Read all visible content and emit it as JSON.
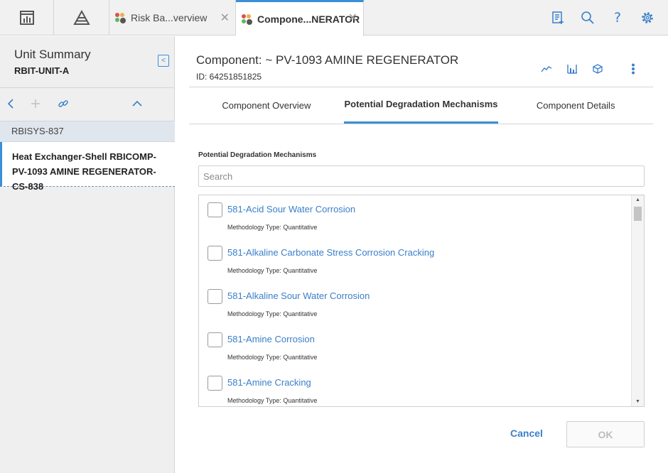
{
  "topbar": {
    "tabs": [
      {
        "label": "Risk Ba...verview",
        "icon": "risk-app-icon"
      },
      {
        "label": "Compone...NERATOR",
        "icon": "risk-app-icon"
      }
    ],
    "icons": [
      "checklist-add-icon",
      "search-icon",
      "help-icon",
      "settings-gear-icon"
    ]
  },
  "left": {
    "title": "Unit Summary",
    "subtitle": "RBIT-UNIT-A",
    "tree": [
      {
        "label": "RBISYS-837"
      },
      {
        "label": "Heat Exchanger-Shell RBICOMP-PV-1093 AMINE REGENERATOR-CS-838"
      }
    ]
  },
  "main": {
    "title": "Component: ~ PV-1093 AMINE REGENERATOR",
    "id_text": "ID: 64251851825",
    "tabs": [
      {
        "label": "Component Overview"
      },
      {
        "label": "Potential Degradation Mechanisms"
      },
      {
        "label": "Component Details"
      }
    ],
    "section_label": "Potential Degradation Mechanisms",
    "search_placeholder": "Search",
    "items": [
      {
        "name": "581-Acid Sour Water Corrosion",
        "methodology": "Methodology Type: Quantitative"
      },
      {
        "name": "581-Alkaline Carbonate Stress Corrosion Cracking",
        "methodology": "Methodology Type: Quantitative"
      },
      {
        "name": "581-Alkaline Sour Water Corrosion",
        "methodology": "Methodology Type: Quantitative"
      },
      {
        "name": "581-Amine Corrosion",
        "methodology": "Methodology Type: Quantitative"
      },
      {
        "name": "581-Amine Cracking",
        "methodology": "Methodology Type: Quantitative"
      }
    ],
    "cancel_label": "Cancel",
    "ok_label": "OK"
  },
  "colors": {
    "accent": "#3a8fd8",
    "link": "#3a7fc9"
  }
}
